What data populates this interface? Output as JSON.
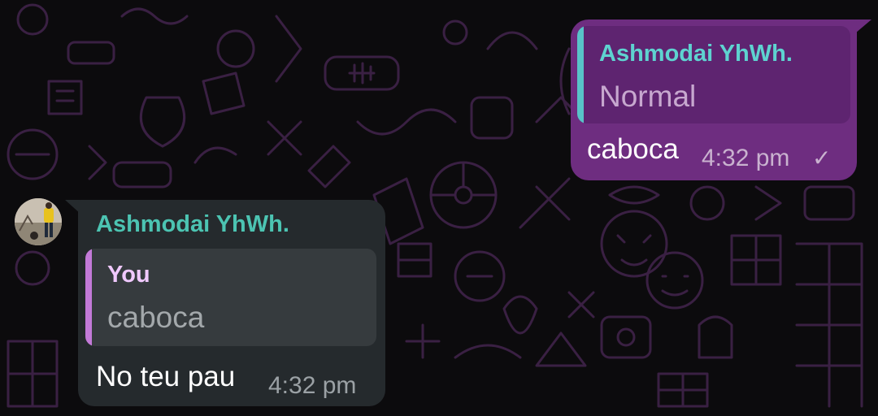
{
  "colors": {
    "background": "#0c0b0d",
    "doodle": "#3a2043",
    "outgoing_bubble": "#6e2d80",
    "outgoing_quote": "#5e2470",
    "outgoing_quote_bar": "#58c3c8",
    "incoming_bubble": "#252a2d",
    "incoming_quote": "#363b3e",
    "incoming_quote_bar": "#c37ad8",
    "sender_name": "#4cc4b2"
  },
  "messages": [
    {
      "direction": "outgoing",
      "reply_to": {
        "author": "Ashmodai YhWh.",
        "text": "Normal"
      },
      "text": "caboca",
      "time": "4:32 pm",
      "status_icon": "single-check-icon",
      "status_glyph": "✓"
    },
    {
      "direction": "incoming",
      "sender": "Ashmodai YhWh.",
      "avatar": "avatar-photo",
      "reply_to": {
        "author": "You",
        "text": "caboca"
      },
      "text": "No teu pau",
      "time": "4:32 pm"
    }
  ]
}
